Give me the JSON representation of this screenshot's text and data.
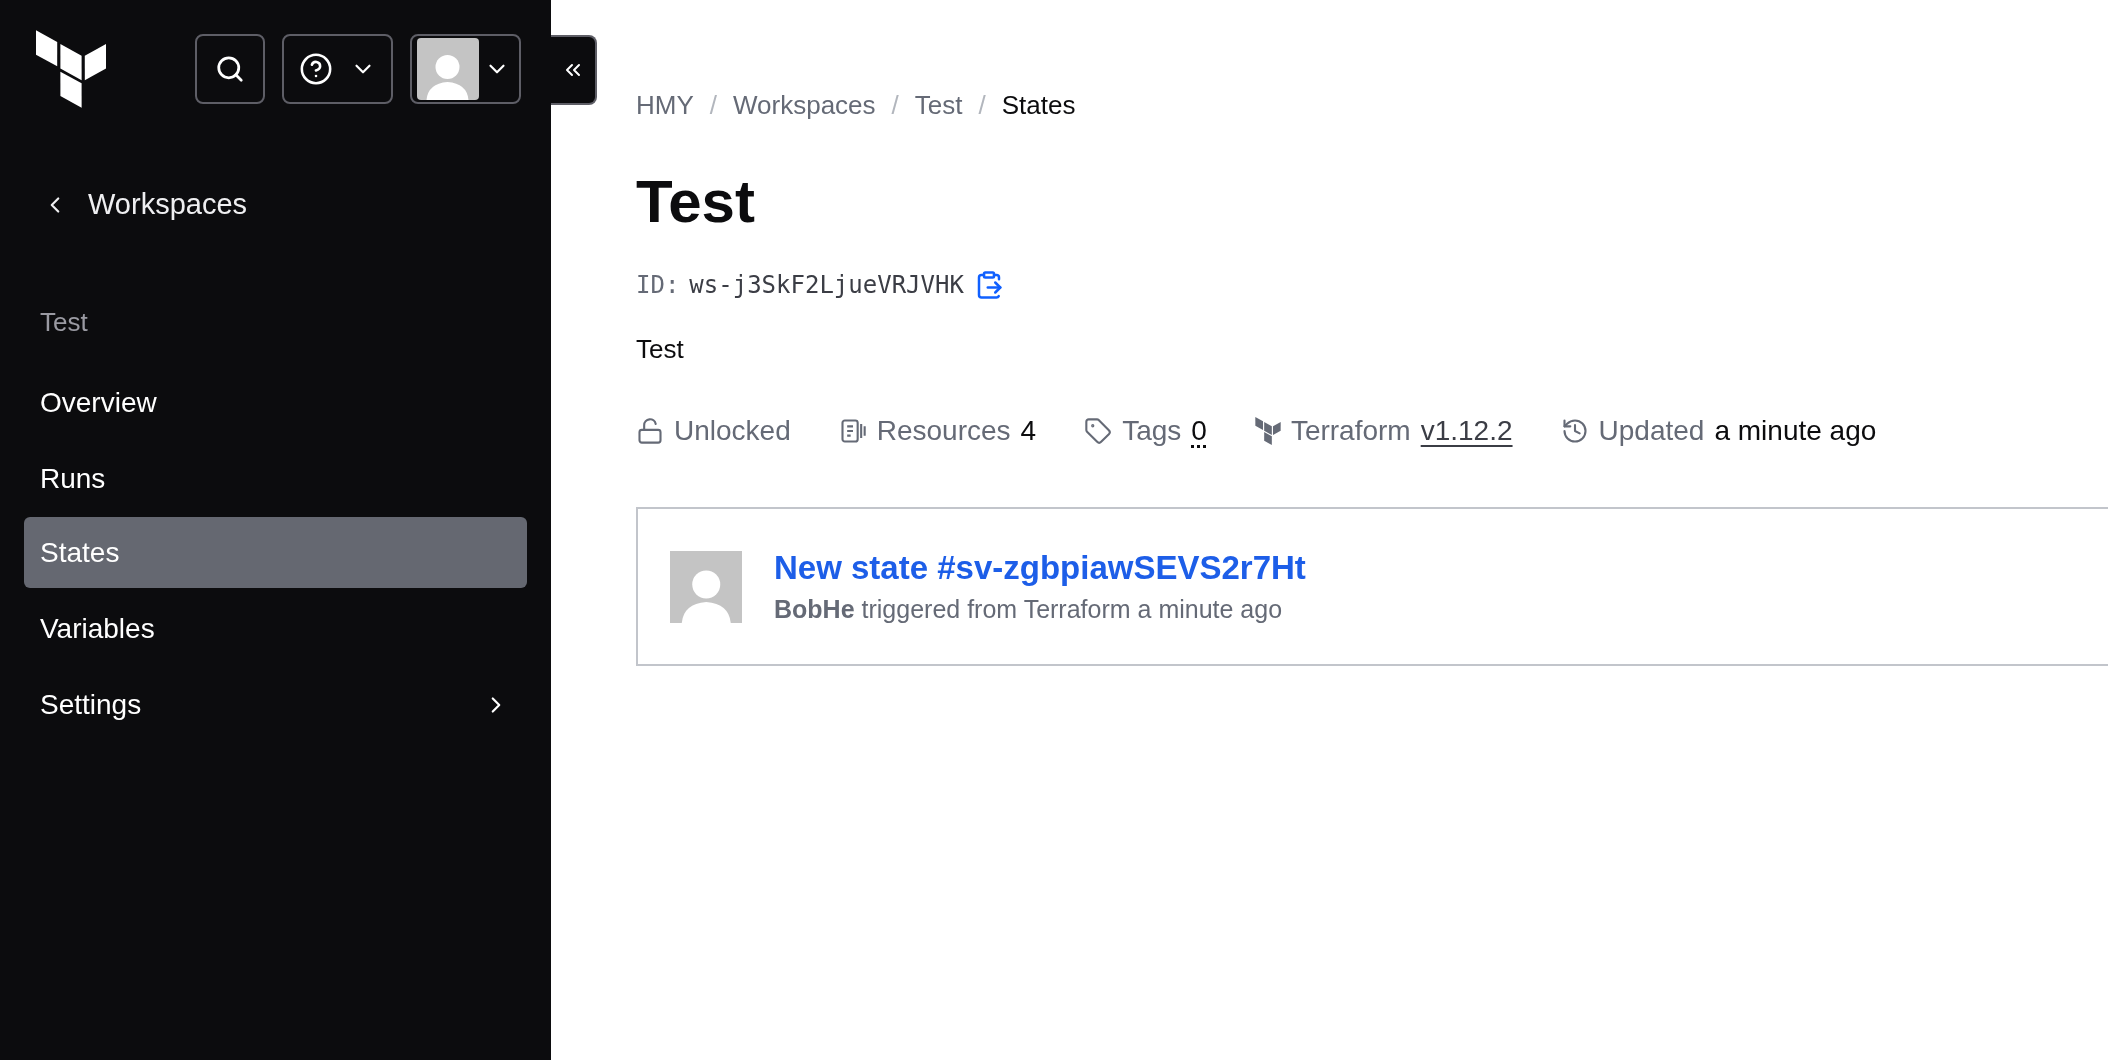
{
  "sidebar": {
    "back_link": "Workspaces",
    "section_label": "Test",
    "items": [
      {
        "label": "Overview",
        "selected": false,
        "kind": "link"
      },
      {
        "label": "Runs",
        "selected": false,
        "kind": "link"
      },
      {
        "label": "States",
        "selected": true,
        "kind": "link"
      },
      {
        "label": "Variables",
        "selected": false,
        "kind": "link"
      },
      {
        "label": "Settings",
        "selected": false,
        "kind": "expandable"
      }
    ]
  },
  "breadcrumbs": [
    {
      "label": "HMY",
      "current": false
    },
    {
      "separator": "/",
      "label": "Workspaces",
      "current": false
    },
    {
      "separator": "/",
      "label": "Test",
      "current": false
    },
    {
      "separator": "/",
      "label": "States",
      "current": true
    }
  ],
  "title": "Test",
  "id_label": "ID:",
  "id_value": "ws-j3SkF2LjueVRJVHK",
  "description": "Test",
  "meta": [
    {
      "kind": "lock",
      "label": "Unlocked"
    },
    {
      "kind": "resources",
      "label": "Resources",
      "value": "4",
      "underlined": false
    },
    {
      "kind": "tags",
      "label": "Tags",
      "value": "0",
      "underlined": true,
      "dotted": true
    },
    {
      "kind": "terraform",
      "label": "Terraform",
      "value": "v1.12.2",
      "underlined": true,
      "dotted": false
    },
    {
      "kind": "updated",
      "label": "Updated",
      "value": "a minute ago",
      "underlined": false
    }
  ],
  "states": [
    {
      "title": "New state #sv-zgbpiawSEVS2r7Ht",
      "user": "BobHe",
      "text": "triggered from Terraform a minute ago"
    }
  ]
}
